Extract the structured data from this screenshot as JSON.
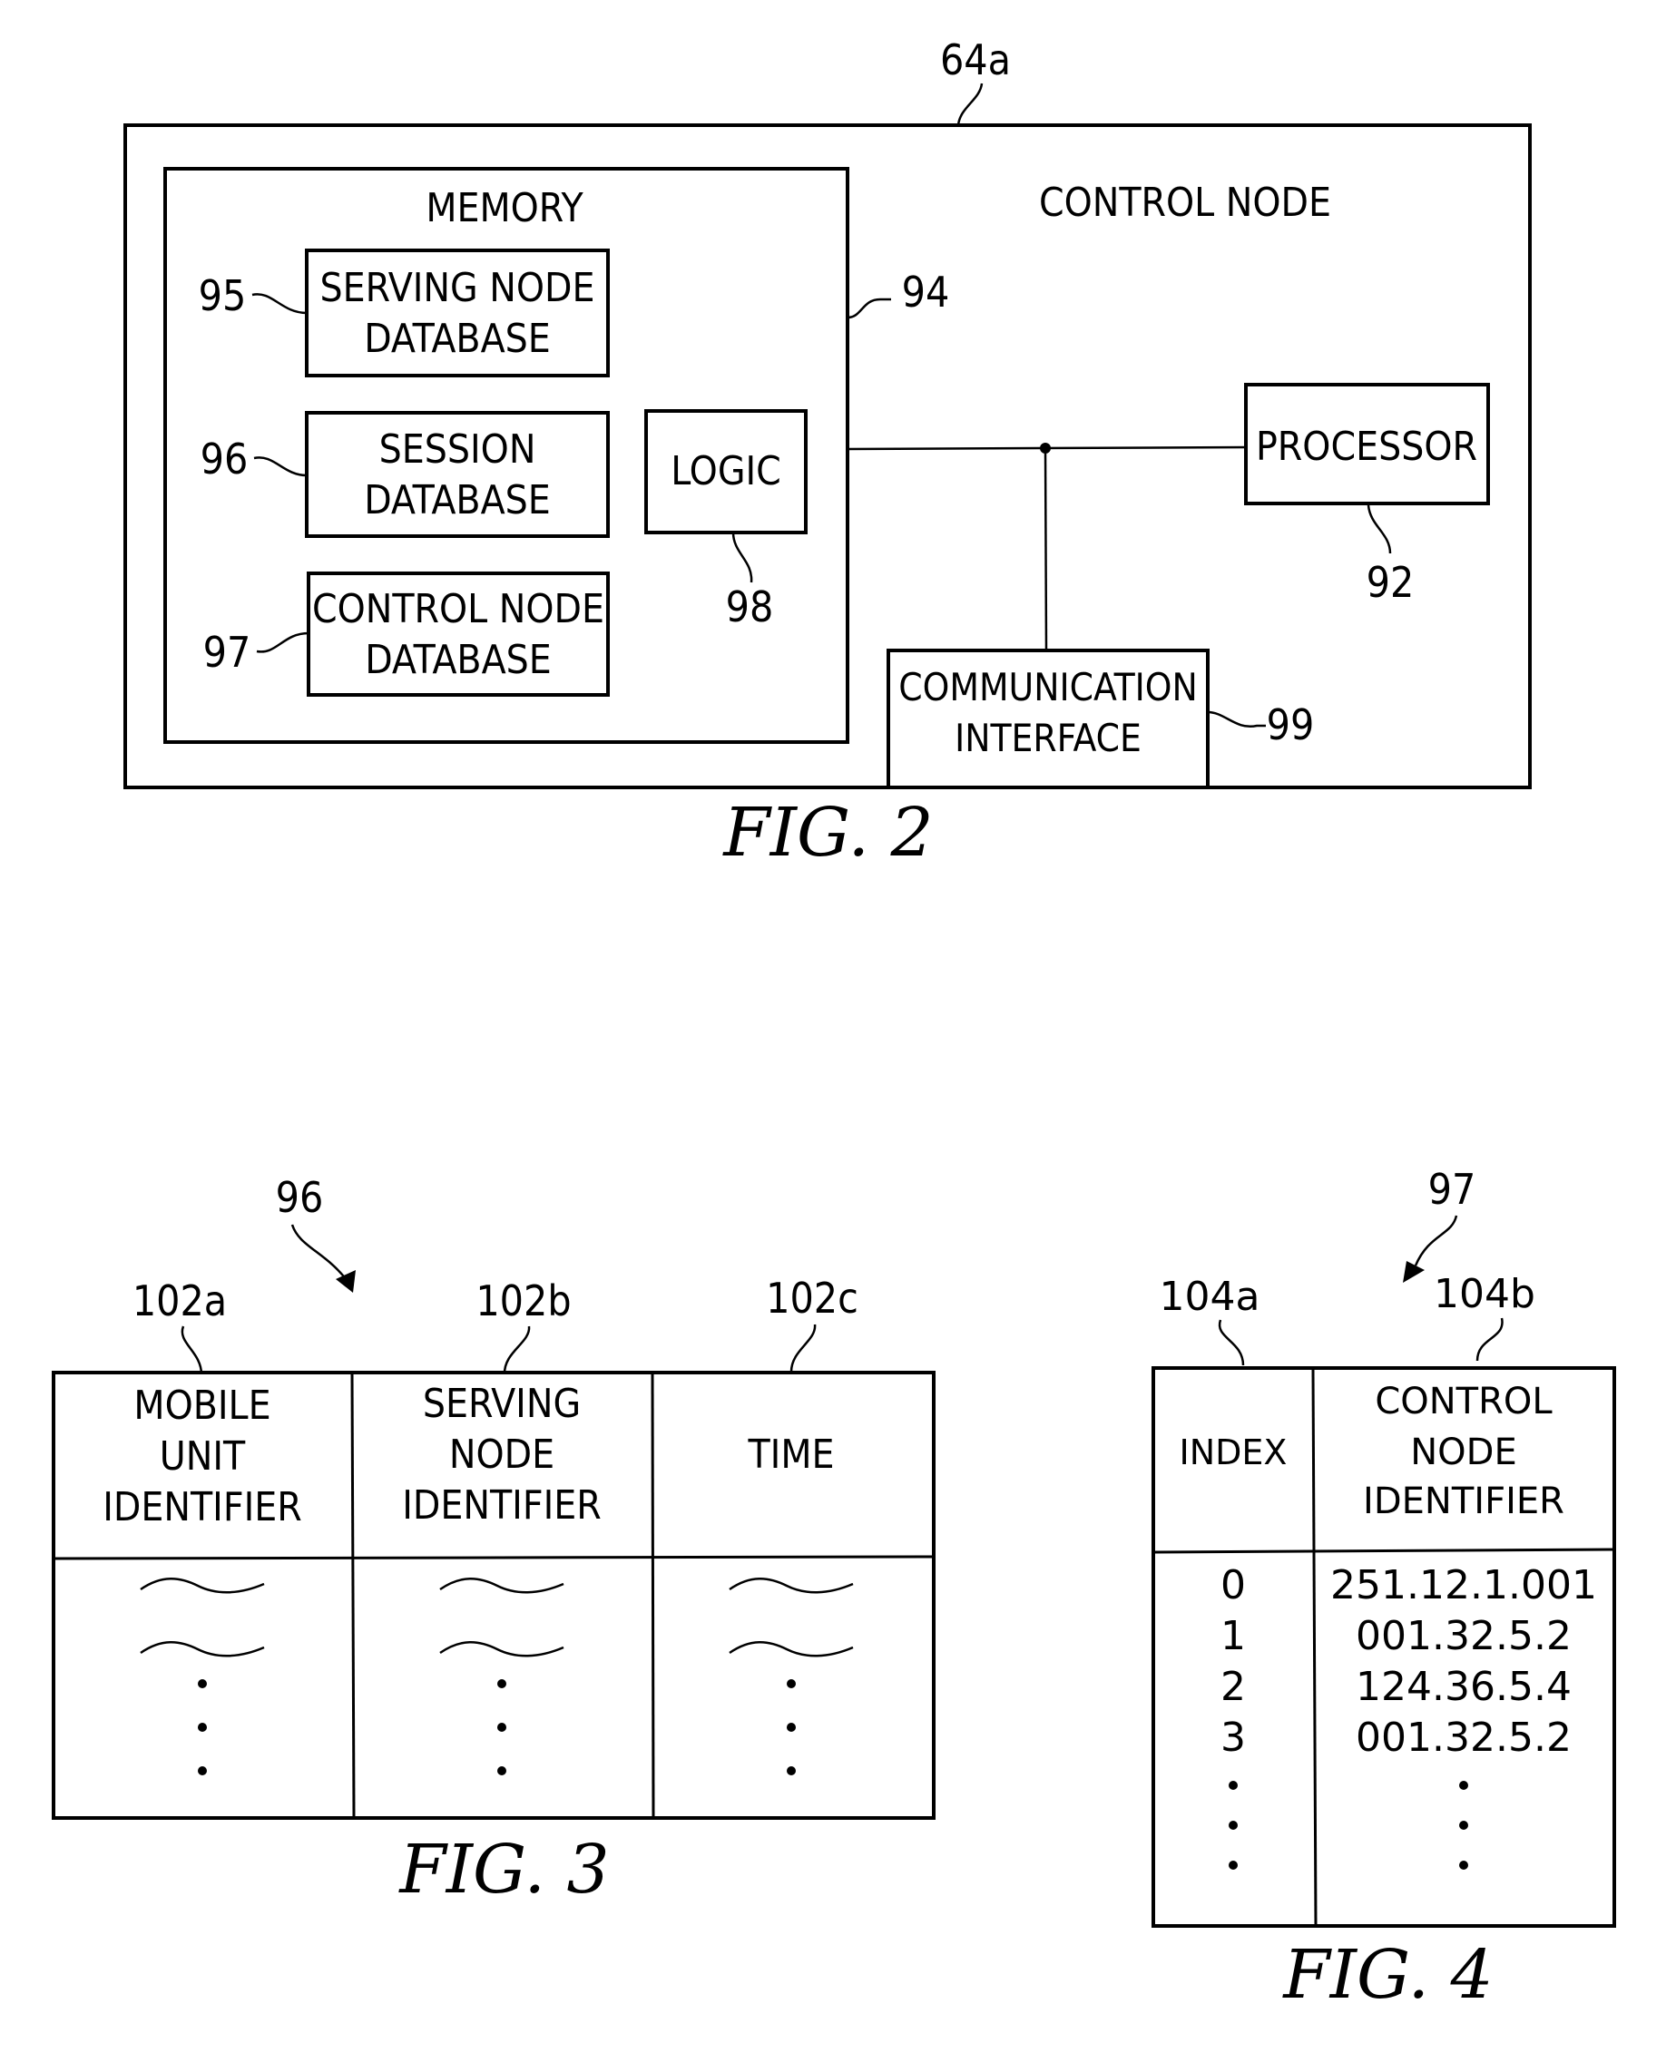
{
  "fig2": {
    "caption": "FIG.  2",
    "ref_outer": "64a",
    "control_node_label": "CONTROL NODE",
    "memory": {
      "title": "MEMORY",
      "ref": "94"
    },
    "serving_node_db": {
      "line1": "SERVING  NODE",
      "line2": "DATABASE",
      "ref": "95"
    },
    "session_db": {
      "line1": "SESSION",
      "line2": "DATABASE",
      "ref": "96"
    },
    "control_node_db": {
      "line1": "CONTROL  NODE",
      "line2": "DATABASE",
      "ref": "97"
    },
    "logic": {
      "label": "LOGIC",
      "ref": "98"
    },
    "processor": {
      "label": "PROCESSOR",
      "ref": "92"
    },
    "comm_interface": {
      "line1": "COMMUNICATION",
      "line2": "INTERFACE",
      "ref": "99"
    }
  },
  "fig3": {
    "caption": "FIG.  3",
    "ref_table": "96",
    "columns": [
      {
        "ref": "102a",
        "header": [
          "MOBILE",
          "UNIT",
          "IDENTIFIER"
        ]
      },
      {
        "ref": "102b",
        "header": [
          "SERVING",
          "NODE",
          "IDENTIFIER"
        ]
      },
      {
        "ref": "102c",
        "header": [
          "TIME"
        ]
      }
    ],
    "placeholder_rows": 2,
    "continuation": "⋮"
  },
  "fig4": {
    "caption": "FIG.  4",
    "ref_table": "97",
    "columns": [
      {
        "ref": "104a",
        "header": [
          "INDEX"
        ]
      },
      {
        "ref": "104b",
        "header": [
          "CONTROL",
          "NODE",
          "IDENTIFIER"
        ]
      }
    ],
    "rows": [
      {
        "index": "0",
        "identifier": "251.12.1.001"
      },
      {
        "index": "1",
        "identifier": "001.32.5.2"
      },
      {
        "index": "2",
        "identifier": "124.36.5.4"
      },
      {
        "index": "3",
        "identifier": "001.32.5.2"
      }
    ]
  }
}
